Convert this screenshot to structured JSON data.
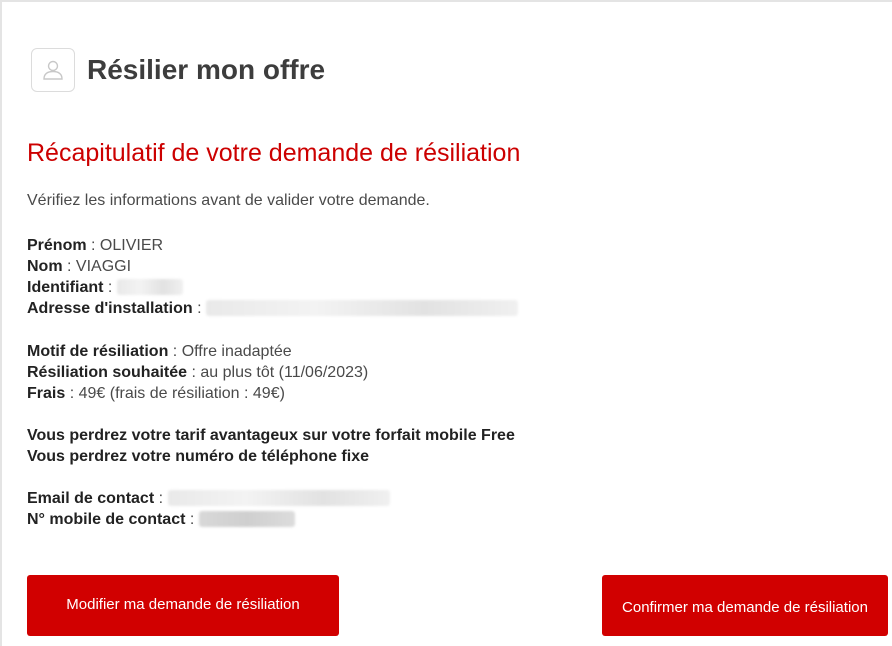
{
  "header": {
    "title": "Résilier mon offre",
    "icon": "user-icon"
  },
  "summary": {
    "title": "Récapitulatif de votre demande de résiliation",
    "intro": "Vérifiez les informations avant de valider votre demande."
  },
  "customer": {
    "first_name_label": "Prénom",
    "first_name": "OLIVIER",
    "last_name_label": "Nom",
    "last_name": "VIAGGI",
    "identifier_label": "Identifiant",
    "address_label": "Adresse d'installation"
  },
  "termination": {
    "reason_label": "Motif de résiliation",
    "reason": "Offre inadaptée",
    "date_label": "Résiliation souhaitée",
    "date": "au plus tôt (11/06/2023)",
    "fees_label": "Frais",
    "fees": "49€ (frais de résiliation : 49€)"
  },
  "warnings": {
    "mobile_rate": "Vous perdrez votre tarif avantageux sur votre forfait mobile Free",
    "landline": "Vous perdrez votre numéro de téléphone fixe"
  },
  "contact": {
    "email_label": "Email de contact",
    "mobile_label": "N° mobile de contact"
  },
  "buttons": {
    "modify": "Modifier ma demande de résiliation",
    "confirm": "Confirmer ma demande de résiliation"
  },
  "colors": {
    "accent": "#cc0000",
    "button": "#d10000"
  }
}
